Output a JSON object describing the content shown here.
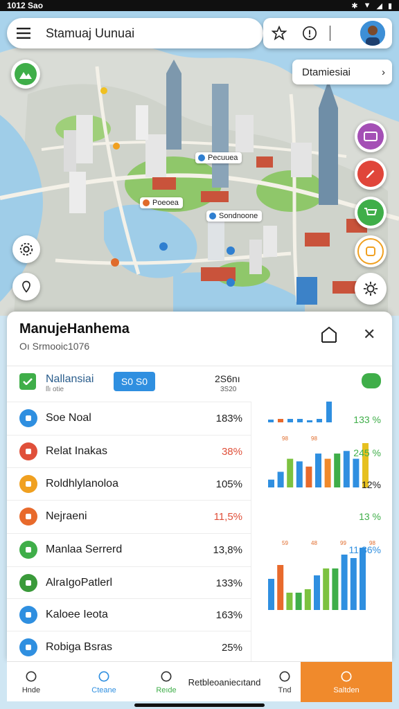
{
  "status_bar": {
    "time": "1012 Sao"
  },
  "search": {
    "text": "Stamuaj Uunuai"
  },
  "destination": {
    "label": "Dtamiesiai"
  },
  "map_labels": [
    {
      "text": "Pecuuea"
    },
    {
      "text": "Sondnoone"
    },
    {
      "text": "Poeoea"
    }
  ],
  "sheet": {
    "title": "ManujeHanhema",
    "subtitle": "Oı Srmooic1076",
    "summary": {
      "name": "Nallansiai",
      "sub": "ſſı  otie",
      "badge": "S0 S0",
      "value": "2S6nı",
      "value2": "3S20"
    },
    "rows": [
      {
        "name": "Soe Noal",
        "value": "183%",
        "color": "#222222",
        "icon_bg": "#2f8fe0",
        "icon": "chart-icon"
      },
      {
        "name": "Relat Inakas",
        "value": "38%",
        "color": "#e0503a",
        "icon_bg": "#e0503a",
        "icon": "tag-icon"
      },
      {
        "name": "Roldhlylanoloa",
        "value": "105%",
        "color": "#222222",
        "icon_bg": "#f0a020",
        "icon": "bulb-icon"
      },
      {
        "name": "Nejraeni",
        "value": "11,5%",
        "color": "#e0503a",
        "icon_bg": "#e86a2c",
        "icon": "fire-icon"
      },
      {
        "name": "Manlaa Serrerd",
        "value": "13,8%",
        "color": "#222222",
        "icon_bg": "#3fae49",
        "icon": "leaf-icon"
      },
      {
        "name": "AlraIgoPatlerl",
        "value": "133%",
        "color": "#222222",
        "icon_bg": "#3a9a3a",
        "icon": "box-icon"
      },
      {
        "name": "Kaloee Ieota",
        "value": "163%",
        "color": "#222222",
        "icon_bg": "#2f8fe0",
        "icon": "circle-icon"
      },
      {
        "name": "Robiga Bsras",
        "value": "25%",
        "color": "#222222",
        "icon_bg": "#2f8fe0",
        "icon": "card-icon"
      }
    ],
    "right_values": [
      {
        "value": "133 %",
        "color": "#3fae49"
      },
      {
        "value": "245 %",
        "color": "#3fae49"
      },
      {
        "value": "12%",
        "color": "#222222"
      },
      {
        "value": "13 %",
        "color": "#3fae49"
      },
      {
        "value": "11,36%",
        "color": "#2f8fe0"
      }
    ]
  },
  "nav": [
    {
      "label": "Hnde",
      "icon": "home-icon"
    },
    {
      "label": "Cteane",
      "icon": "clock-icon"
    },
    {
      "label": "Reıde",
      "icon": "globe-icon"
    },
    {
      "label": "Retbleoaniecıtand",
      "icon": ""
    },
    {
      "label": "Tnd",
      "icon": "compass-icon"
    },
    {
      "label": "Saltden",
      "icon": "search-icon"
    }
  ],
  "chart_data": [
    {
      "type": "bar",
      "series": [
        {
          "values": [
            4,
            5,
            5,
            5,
            3,
            5,
            100
          ]
        }
      ],
      "colors": [
        "#2f8fe0",
        "#e86a2c",
        "#2f8fe0",
        "#2f8fe0",
        "#2f8fe0",
        "#2f8fe0",
        "#2f8fe0"
      ],
      "label_top": "93"
    },
    {
      "type": "bar",
      "series": [
        {
          "values": [
            15,
            30,
            55,
            50,
            40,
            65,
            55,
            65,
            70,
            55,
            85
          ]
        }
      ],
      "colors": [
        "#2f8fe0",
        "#2f8fe0",
        "#7cc240",
        "#2f8fe0",
        "#e86a2c",
        "#2f8fe0",
        "#f08a2c",
        "#3fae49",
        "#2f8fe0",
        "#2f8fe0",
        "#e6c020"
      ],
      "labels": [
        "98",
        "98"
      ]
    },
    {
      "type": "bar",
      "series": [
        {
          "values": [
            45,
            65,
            25,
            25,
            30,
            50,
            60,
            60,
            80,
            75,
            90
          ]
        }
      ],
      "colors": [
        "#2f8fe0",
        "#e86a2c",
        "#7cc240",
        "#3fae49",
        "#7cc240",
        "#2f8fe0",
        "#7cc240",
        "#3fae49",
        "#2f8fe0",
        "#2f8fe0",
        "#2f8fe0"
      ],
      "labels": [
        "59",
        "48",
        "99",
        "98"
      ]
    }
  ]
}
